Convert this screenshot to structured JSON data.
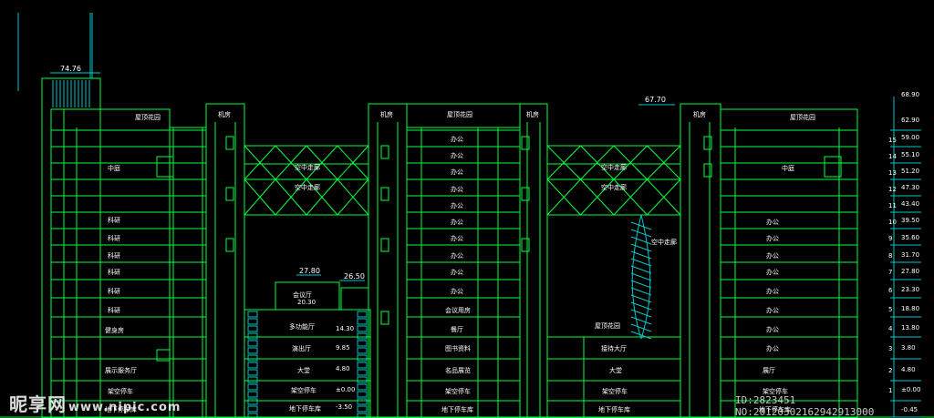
{
  "colors": {
    "background": "#000000",
    "line": "#00ff3c",
    "dim": "#00c8c8",
    "text": "#ffffff",
    "yellow": "#ffff00"
  },
  "level_marks": {
    "top": [
      "74.76",
      "67.70"
    ],
    "mid": [
      "27.80",
      "26.50",
      "20.30",
      "14.30",
      "9.85",
      "4.80",
      "±0.00",
      "-3.50"
    ]
  },
  "right_axis": {
    "elevations": [
      "68.90",
      "62.90",
      "59.00",
      "55.10",
      "51.20",
      "47.30",
      "43.40",
      "39.50",
      "35.60",
      "31.70",
      "27.80",
      "23.30",
      "18.80",
      "13.80",
      "3.80",
      "4.80",
      "±0.00",
      "-0.45"
    ],
    "floors": [
      "15",
      "14",
      "13",
      "12",
      "11",
      "10",
      "9",
      "8",
      "7",
      "6",
      "5",
      "4",
      "3",
      "2",
      "1"
    ]
  },
  "labels": {
    "roof_garden": "屋顶花园",
    "machine_room": "机房",
    "sky_corridor": "空中走廊",
    "office": "办公",
    "research": "科研",
    "meeting": "会议厅",
    "meeting_room": "会议用房",
    "multi_hall": "多功能厅",
    "performance": "演出厅",
    "lobby": "大堂",
    "parking": "架空停车",
    "basement": "地下停车库",
    "dining": "餐厅",
    "library": "图书资料",
    "exhibition": "名品展览",
    "conference": "接待大厅",
    "gym": "健身房",
    "show_hall": "展厅",
    "bistro": "展示服务厅",
    "atrium": "中庭"
  },
  "watermark": {
    "brand": "昵享网",
    "url": "www.nipic.com",
    "id": "ID:2823451 NO:20120302162942913000"
  }
}
